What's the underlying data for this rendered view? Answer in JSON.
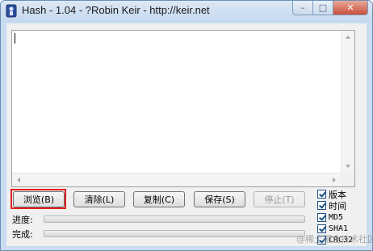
{
  "window": {
    "title": "Hash - 1.04 - ?Robin Keir - http://keir.net",
    "icon": "hash-app-icon",
    "caption_buttons": {
      "minimize": "–",
      "maximize": "□",
      "close": "✕"
    }
  },
  "output": {
    "text": ""
  },
  "buttons": {
    "browse": "浏览(B)",
    "clear": "清除(L)",
    "copy": "复制(C)",
    "save": "保存(S)",
    "stop": "停止(T)"
  },
  "progress": {
    "progress_label": "进度:",
    "progress_value": 0,
    "done_label": "完成:",
    "done_value": 0
  },
  "options": [
    {
      "label": "版本",
      "checked": true
    },
    {
      "label": "时间",
      "checked": true
    },
    {
      "label": "MD5",
      "checked": true
    },
    {
      "label": "SHA1",
      "checked": true
    },
    {
      "label": "CRC32",
      "checked": true
    }
  ],
  "watermark": "@稀土掘金技术社区",
  "colors": {
    "highlight": "#e02020",
    "checkbox": "#1e5184"
  }
}
